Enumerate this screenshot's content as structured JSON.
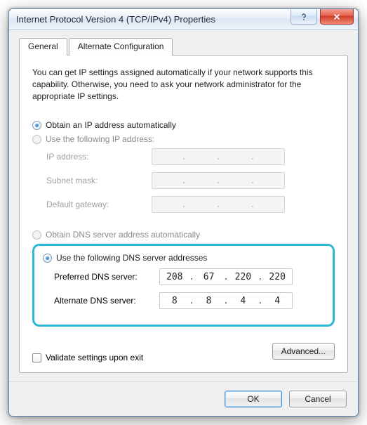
{
  "window": {
    "title": "Internet Protocol Version 4 (TCP/IPv4) Properties"
  },
  "tabs": {
    "general": "General",
    "alt": "Alternate Configuration"
  },
  "intro": "You can get IP settings assigned automatically if your network supports this capability. Otherwise, you need to ask your network administrator for the appropriate IP settings.",
  "ip": {
    "auto_label": "Obtain an IP address automatically",
    "manual_label": "Use the following IP address:",
    "mode": "auto",
    "fields": {
      "ip_label": "IP address:",
      "mask_label": "Subnet mask:",
      "gw_label": "Default gateway:",
      "ip": [
        "",
        "",
        "",
        ""
      ],
      "mask": [
        "",
        "",
        "",
        ""
      ],
      "gw": [
        "",
        "",
        "",
        ""
      ]
    }
  },
  "dns": {
    "auto_label": "Obtain DNS server address automatically",
    "manual_label": "Use the following DNS server addresses",
    "mode": "manual",
    "fields": {
      "pref_label": "Preferred DNS server:",
      "alt_label": "Alternate DNS server:",
      "pref": [
        "208",
        "67",
        "220",
        "220"
      ],
      "alt": [
        "8",
        "8",
        "4",
        "4"
      ]
    }
  },
  "validate_label": "Validate settings upon exit",
  "buttons": {
    "advanced": "Advanced...",
    "ok": "OK",
    "cancel": "Cancel"
  }
}
